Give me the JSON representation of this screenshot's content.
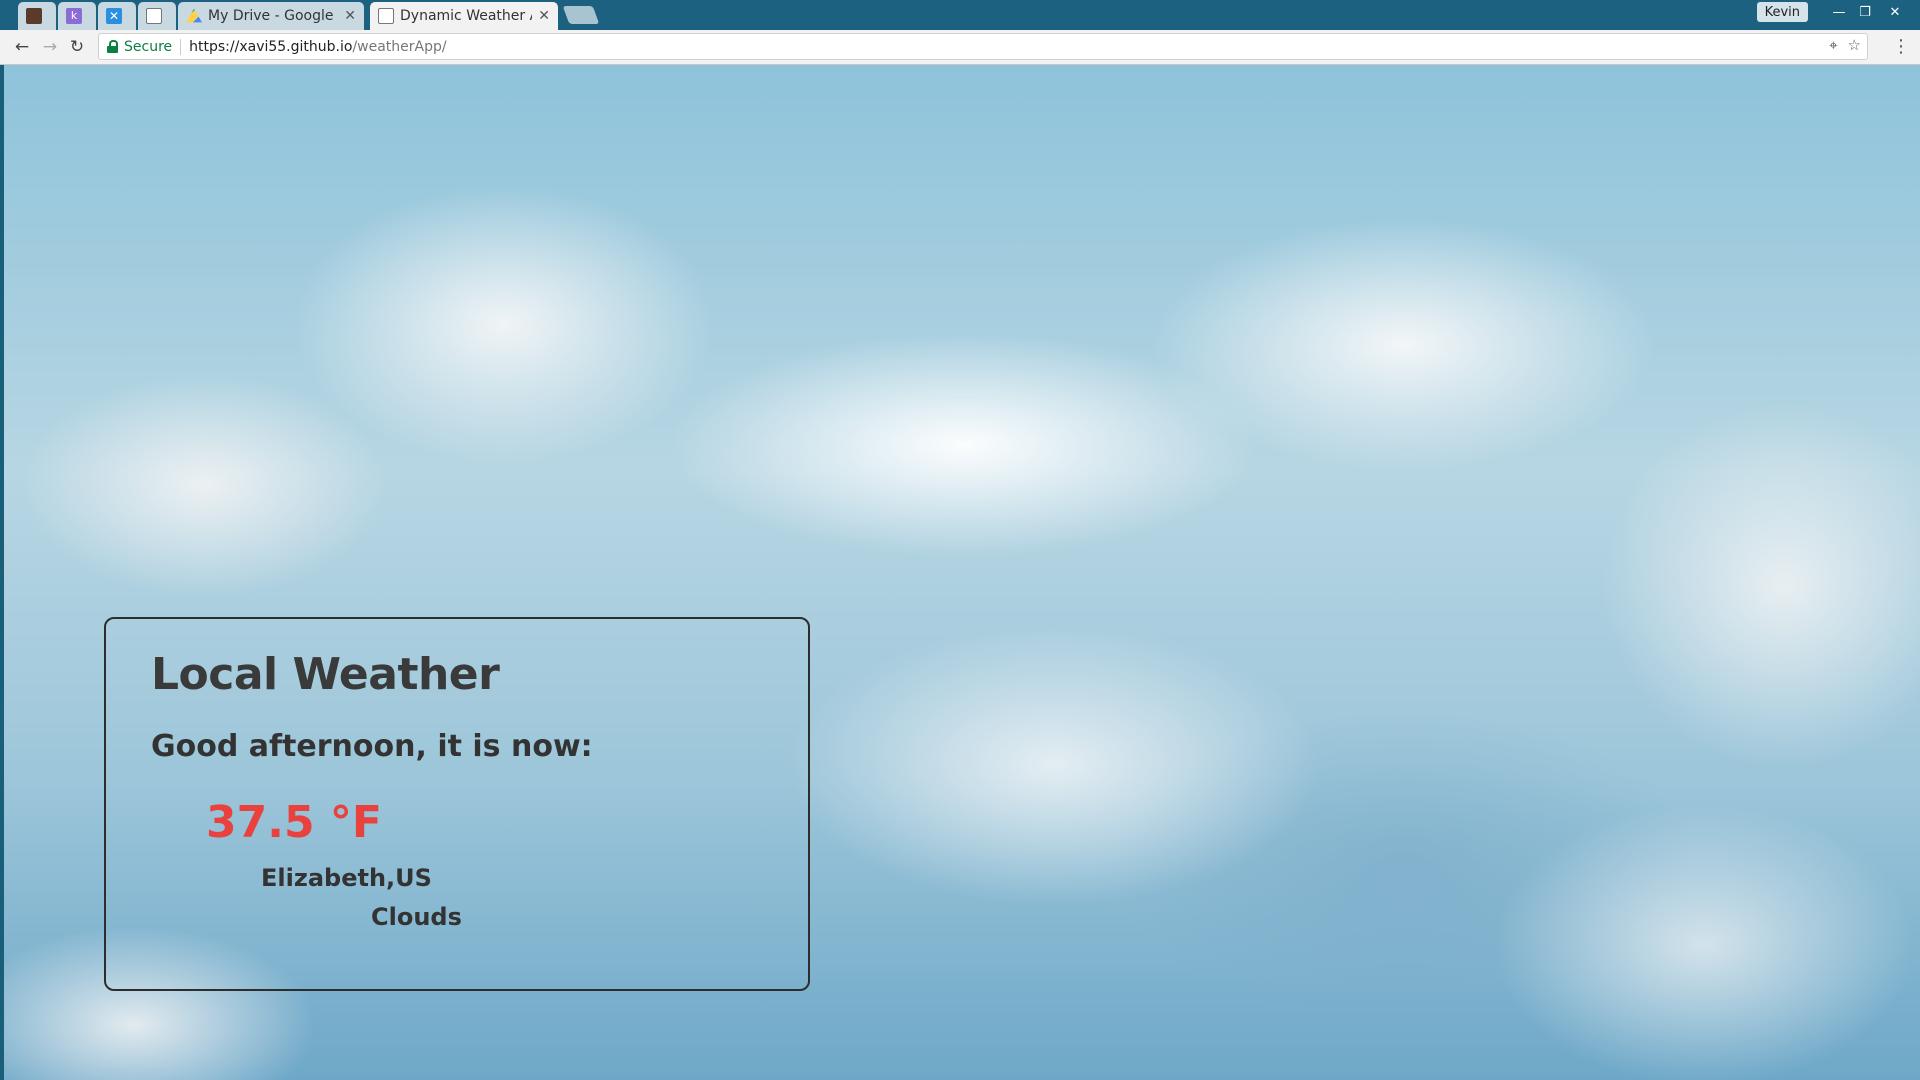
{
  "browser": {
    "tabs": [
      {
        "title": "",
        "favicon": "dark-app-icon",
        "active": false
      },
      {
        "title": "",
        "favicon": "purple-k-icon",
        "active": false
      },
      {
        "title": "",
        "favicon": "x-blue-icon",
        "active": false
      },
      {
        "title": "",
        "favicon": "document-icon",
        "active": false
      },
      {
        "title": "My Drive - Google D",
        "favicon": "google-drive-icon",
        "active": false
      },
      {
        "title": "Dynamic Weather A",
        "favicon": "document-icon",
        "active": true
      }
    ],
    "profile_name": "Kevin",
    "secure_label": "Secure",
    "url_host": "https://xavi55.github.io",
    "url_path": "/weatherApp/"
  },
  "weather": {
    "heading": "Local Weather",
    "greeting": "Good afternoon, it is now:",
    "temperature": "37.5 °F",
    "location": "Elizabeth,US",
    "condition": "Clouds"
  },
  "colors": {
    "accent_temp": "#e8413e",
    "titlebar": "#1c6280",
    "secure_green": "#0b8043"
  }
}
